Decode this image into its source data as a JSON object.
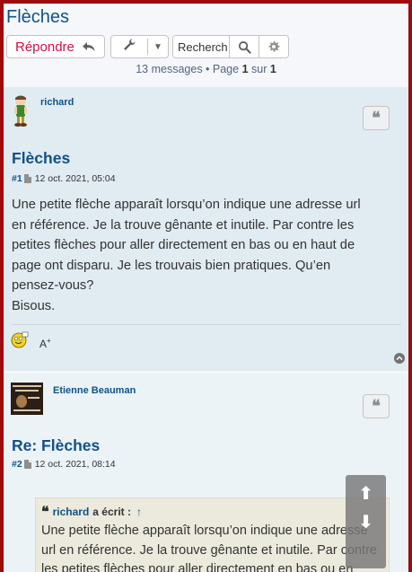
{
  "topic": {
    "title": "Flèches"
  },
  "toolbar": {
    "reply_label": "Répondre",
    "reply_icon": "reply-icon",
    "tools_icon": "wrench-icon",
    "dropdown_icon": "caret-down-icon",
    "search_placeholder": "Recherche…",
    "search_value": "Recherch",
    "search_icon": "search-icon",
    "advanced_search_icon": "gear-icon"
  },
  "pagination": {
    "count_text": "13 messages • Page ",
    "page": "1",
    "of_text": " sur ",
    "total": "1"
  },
  "posts": [
    {
      "username": "richard",
      "quote_label": "❝",
      "title": "Flèches",
      "number": "#1",
      "date": "12 oct. 2021, 05:04",
      "content": "Une petite flèche apparaît lorsqu’on indique une adresse url\nen référence. Je la trouve gênante et inutile. Par contre les\npetites flèches pour aller directement en bas ou en haut de\npage ont disparu. Je les trouvais bien pratiques. Qu’en\npensez-vous?\nBisous.",
      "font_size_label": "A",
      "font_size_sup": "+"
    },
    {
      "username": "Etienne Beauman",
      "quote_label": "❝",
      "title": "Re: Flèches",
      "number": "#2",
      "date": "12 oct. 2021, 08:14",
      "quote": {
        "author": "richard",
        "wrote": "a écrit :",
        "arrow": "↑",
        "text": "Une petite flèche apparaît lorsqu’on indique une adresse\nurl en référence. Je la trouve gênante et inutile. Par contre\nles petites flèches pour aller directement en bas ou en"
      }
    }
  ],
  "float_nav": {
    "up": "⬆",
    "down": "⬇"
  },
  "colors": {
    "frame": "#9e0b0f",
    "link": "#105289",
    "reply": "#d31141",
    "post_bg_1": "#e1ebf2",
    "post_bg_2": "#ecf3f7"
  }
}
